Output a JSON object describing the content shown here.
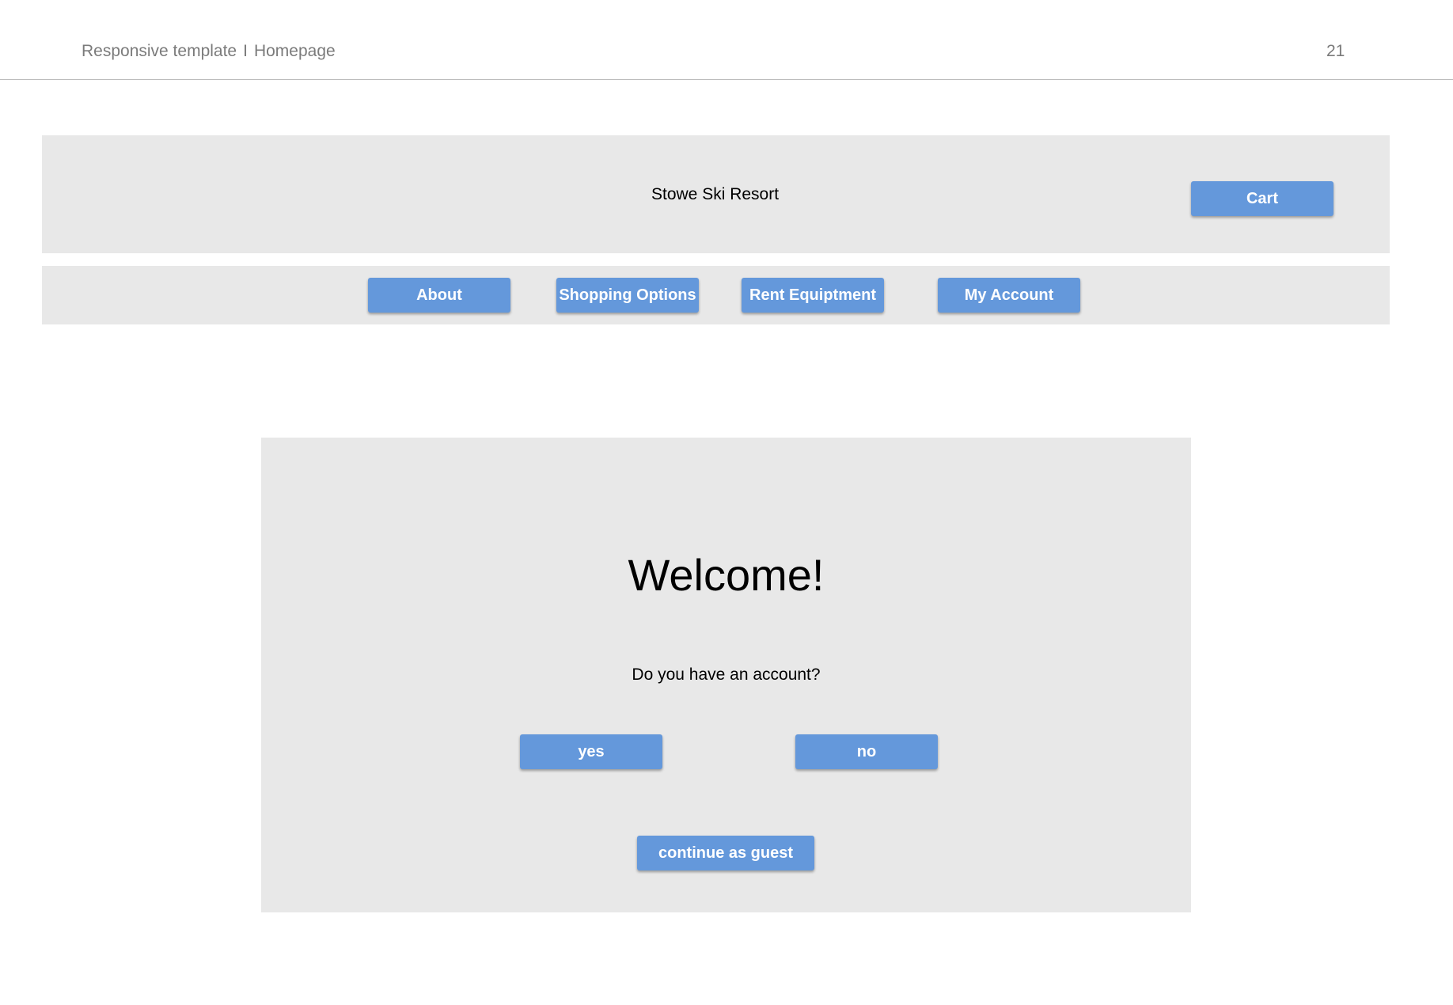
{
  "header": {
    "breadcrumb": {
      "section": "Responsive template",
      "separator": "I",
      "page": "Homepage"
    },
    "page_number": "21"
  },
  "top_bar": {
    "site_title": "Stowe Ski Resort",
    "cart_label": "Cart"
  },
  "nav": {
    "items": [
      {
        "label": "About"
      },
      {
        "label": "Shopping Options"
      },
      {
        "label": "Rent Equiptment"
      },
      {
        "label": "My Account"
      }
    ]
  },
  "welcome": {
    "heading": "Welcome!",
    "question": "Do you have an account?",
    "yes_label": "yes",
    "no_label": "no",
    "guest_label": "continue as guest"
  },
  "colors": {
    "button": "#6498db",
    "panel": "#e8e8e8",
    "header_text": "#7b7b7b"
  }
}
